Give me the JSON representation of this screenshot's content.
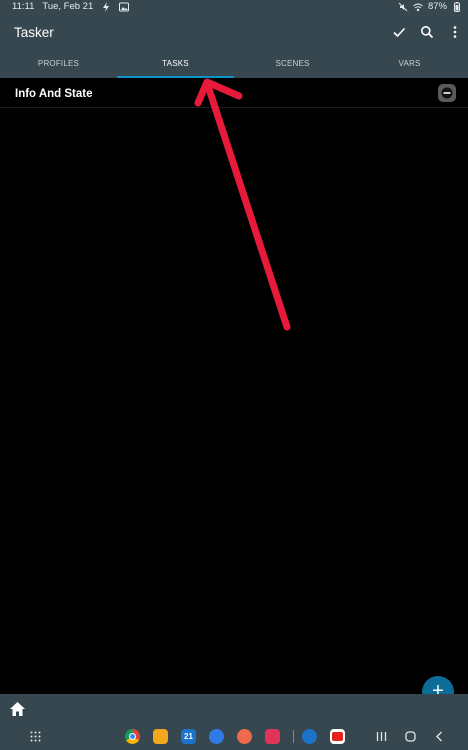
{
  "status_bar": {
    "time": "11:11",
    "date": "Tue, Feb 21",
    "battery": "87%"
  },
  "app_bar": {
    "title": "Tasker",
    "action_icons": [
      "check-icon",
      "search-icon",
      "more-vert-icon"
    ]
  },
  "tabs": [
    {
      "label": "PROFILES",
      "active": false
    },
    {
      "label": "TASKS",
      "active": true
    },
    {
      "label": "SCENES",
      "active": false
    },
    {
      "label": "VARS",
      "active": false
    }
  ],
  "tasks": [
    {
      "name": "Info And State",
      "icon": "task-status-icon"
    }
  ],
  "fab": {
    "symbol": "+",
    "icon": "add-icon"
  },
  "colors": {
    "toolbar": "#37474f",
    "accent": "#0e91c8",
    "fab": "#0c6d98",
    "annotation_arrow": "#e81a3a",
    "background": "#000000"
  },
  "dock": {
    "calendar_day": "21",
    "apps": [
      "chrome-icon",
      "files-icon",
      "calendar-icon",
      "messages-icon",
      "contacts-icon",
      "camera-icon",
      "tasker-icon",
      "youtube-icon"
    ]
  }
}
